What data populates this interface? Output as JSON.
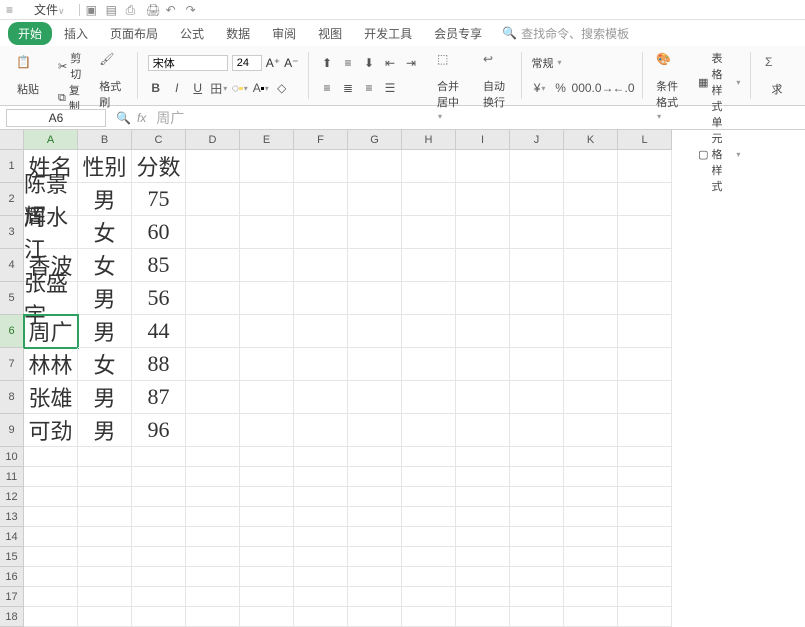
{
  "titlebar": {
    "file": "文件"
  },
  "menu": {
    "tabs": [
      "开始",
      "插入",
      "页面布局",
      "公式",
      "数据",
      "审阅",
      "视图",
      "开发工具",
      "会员专享"
    ],
    "search_placeholder": "查找命令、搜索模板"
  },
  "ribbon": {
    "paste": "粘贴",
    "cut": "剪切",
    "copy": "复制",
    "format_painter": "格式刷",
    "font_name": "宋体",
    "font_size": "24",
    "merge": "合并居中",
    "wrap": "自动换行",
    "general": "常规",
    "cond_fmt": "条件格式",
    "table_style": "表格样式",
    "cell_style": "单元格样式",
    "find": "求"
  },
  "namebox": {
    "ref": "A6",
    "fx_value": "周广"
  },
  "columns": [
    "A",
    "B",
    "C",
    "D",
    "E",
    "F",
    "G",
    "H",
    "I",
    "J",
    "K",
    "L"
  ],
  "active_col": "A",
  "active_row": "6",
  "data_rows": [
    {
      "n": "1",
      "a": "姓名",
      "b": "性别",
      "c": "分数"
    },
    {
      "n": "2",
      "a": "陈景辉",
      "b": "男",
      "c": "75"
    },
    {
      "n": "3",
      "a": "周水江",
      "b": "女",
      "c": "60"
    },
    {
      "n": "4",
      "a": "香波",
      "b": "女",
      "c": "85"
    },
    {
      "n": "5",
      "a": "张盛宇",
      "b": "男",
      "c": "56"
    },
    {
      "n": "6",
      "a": "周广",
      "b": "男",
      "c": "44"
    },
    {
      "n": "7",
      "a": "林林",
      "b": "女",
      "c": "88"
    },
    {
      "n": "8",
      "a": "张雄",
      "b": "男",
      "c": "87"
    },
    {
      "n": "9",
      "a": "可劲",
      "b": "男",
      "c": "96"
    }
  ],
  "empty_rows": [
    "10",
    "11",
    "12",
    "13",
    "14",
    "15",
    "16",
    "17",
    "18"
  ]
}
